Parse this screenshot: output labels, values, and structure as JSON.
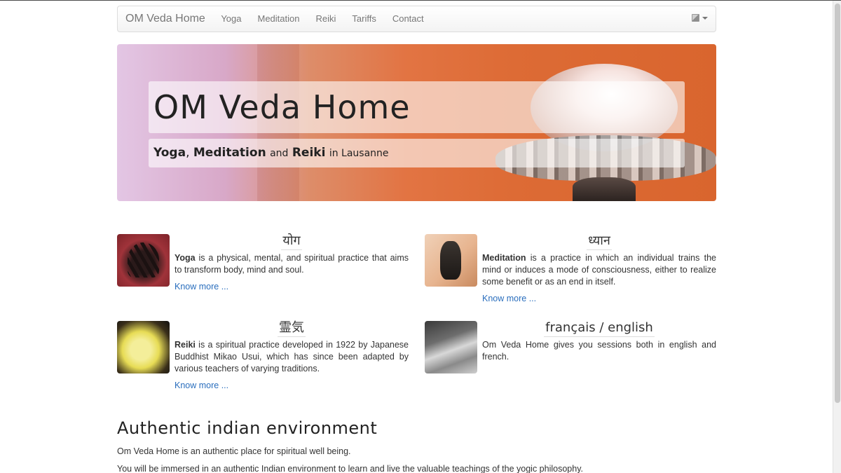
{
  "navbar": {
    "brand": "OM Veda Home",
    "items": [
      {
        "label": "Yoga"
      },
      {
        "label": "Meditation"
      },
      {
        "label": "Reiki"
      },
      {
        "label": "Tariffs"
      },
      {
        "label": "Contact"
      }
    ],
    "language_icon": "flag-icon"
  },
  "hero": {
    "title": "OM Veda Home",
    "subtitle": {
      "yoga": "Yoga",
      "comma": ",",
      "meditation": "Meditation",
      "and": "and",
      "reiki": "Reiki",
      "location": "in Lausanne"
    }
  },
  "features": [
    {
      "heading": "योग",
      "term": "Yoga",
      "text": " is a physical, mental, and spiritual practice that aims to transform body, mind and soul.",
      "link": "Know more ..."
    },
    {
      "heading": "ध्यान",
      "term": "Meditation",
      "text": " is a practice in which an individual trains the mind or induces a mode of consciousness, either to realize some benefit or as an end in itself.",
      "link": "Know more ..."
    },
    {
      "heading": "霊気",
      "term": "Reiki",
      "text": " is a spiritual practice developed in 1922 by Japanese Buddhist Mikao Usui, which has since been adapted by various teachers of varying traditions.",
      "link": "Know more ..."
    },
    {
      "heading": "français / english",
      "text": "Om Veda Home gives you sessions both in english and french."
    }
  ],
  "environment": {
    "title": "Authentic indian environment",
    "p1": "Om Veda Home is an authentic place for spiritual well being.",
    "p2": "You will be immersed in an authentic Indian environment to learn and live the valuable teachings of the yogic philosophy."
  },
  "colors": {
    "link": "#2a6ebd",
    "navbar_text": "#777777",
    "text": "#333333"
  }
}
